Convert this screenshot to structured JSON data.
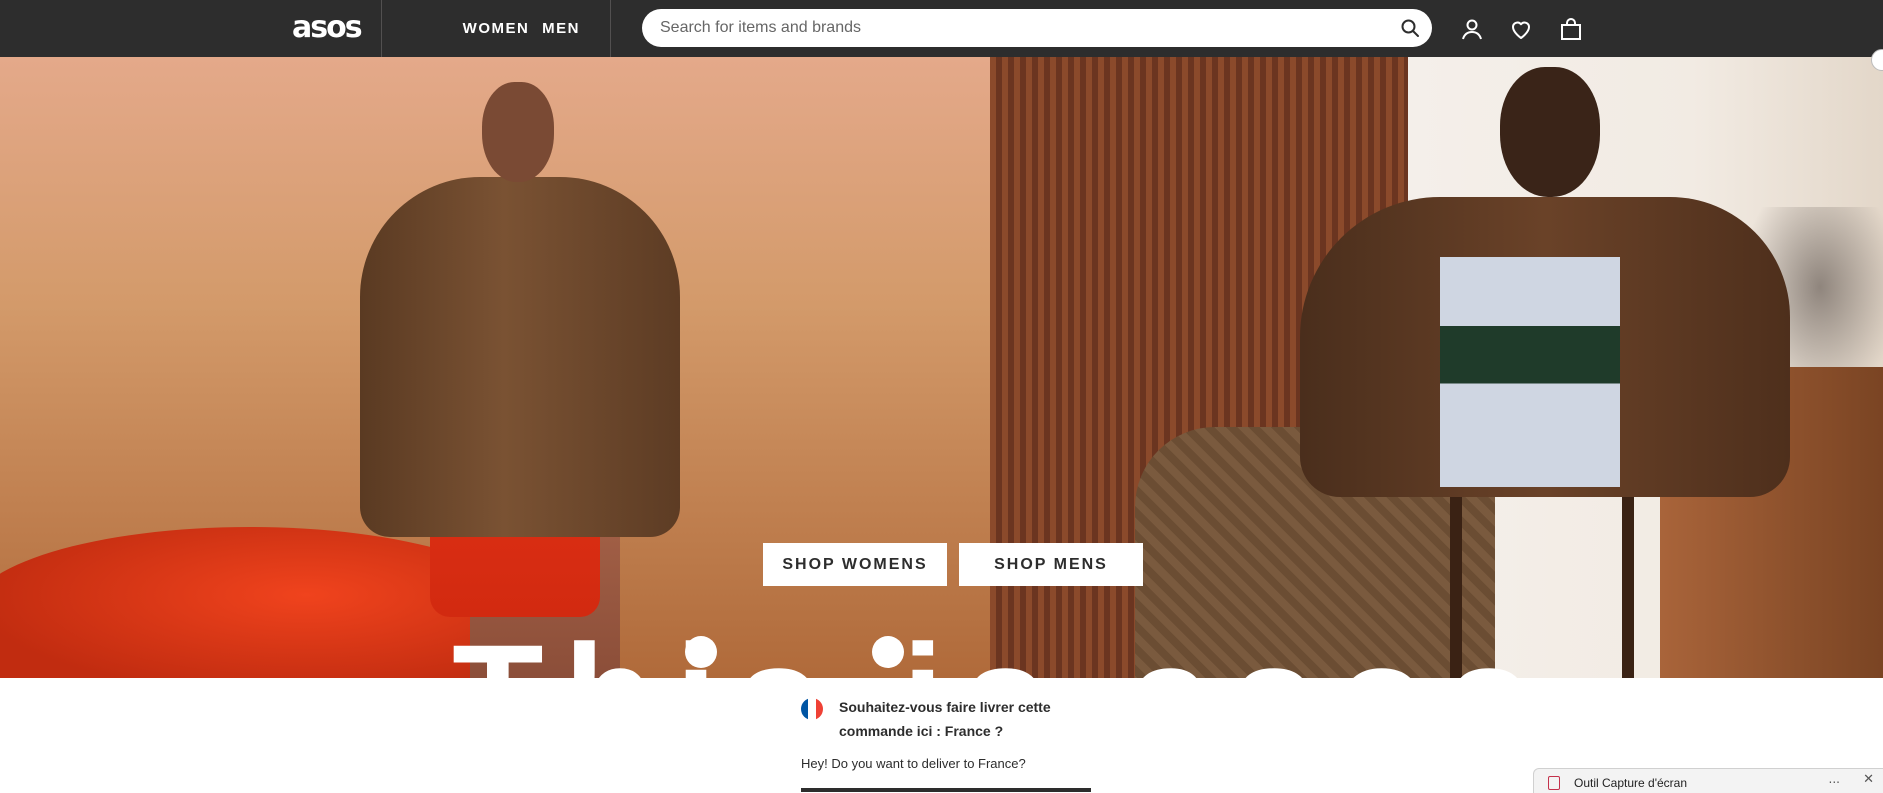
{
  "header": {
    "logo_text": "asos",
    "tabs": [
      {
        "label": "WOMEN"
      },
      {
        "label": "MEN"
      }
    ],
    "search": {
      "placeholder": "Search for items and brands"
    },
    "icons": [
      "user-icon",
      "heart-icon",
      "bag-icon"
    ]
  },
  "hero": {
    "buttons": {
      "shop_womens": "SHOP WOMENS",
      "shop_mens": "SHOP MENS"
    },
    "headline_partial": "This is asos"
  },
  "delivery_popup": {
    "title": "Souhaitez-vous faire livrer cette commande ici : France ?",
    "subtitle": "Hey! Do you want to deliver to France?",
    "flag_colors": [
      "#0055A4",
      "#FFFFFF",
      "#EF4135"
    ]
  },
  "snip_toast": {
    "title": "Outil Capture d'écran",
    "more": "...",
    "close": "✕"
  },
  "colors": {
    "header_bg": "#2d2d2d",
    "text": "#2d2d2d"
  }
}
